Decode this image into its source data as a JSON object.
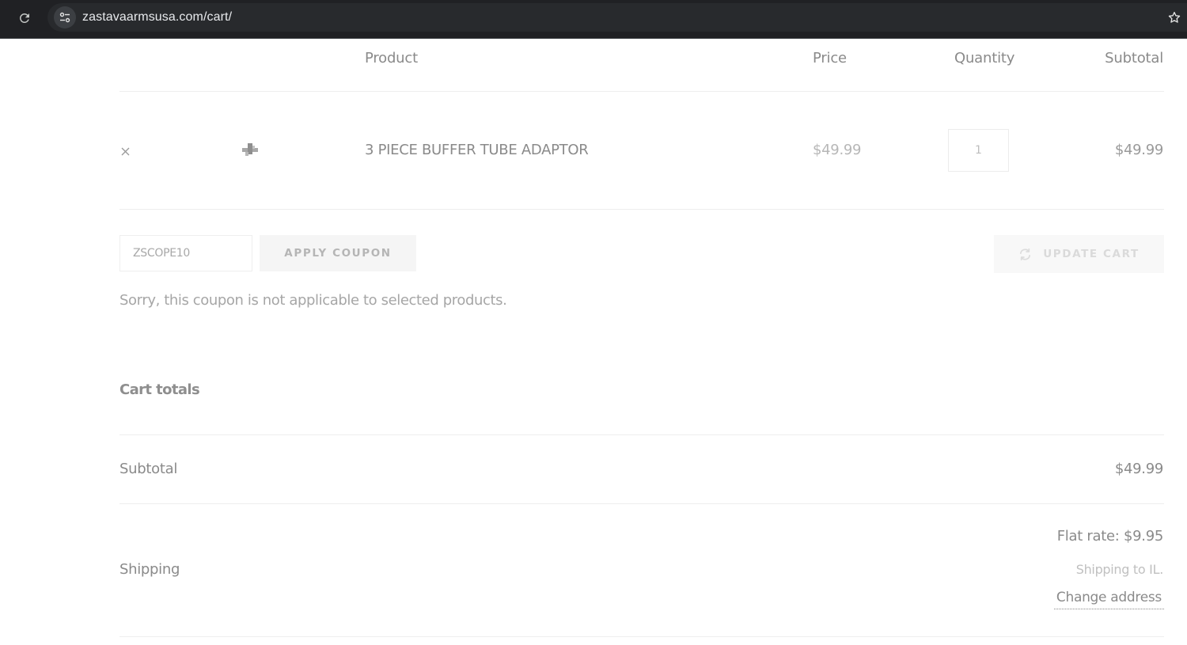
{
  "browser": {
    "url": "zastavaarmsusa.com/cart/"
  },
  "cart": {
    "headers": {
      "product": "Product",
      "price": "Price",
      "quantity": "Quantity",
      "subtotal": "Subtotal"
    },
    "items": [
      {
        "name": "3 PIECE BUFFER TUBE ADAPTOR",
        "price": "$49.99",
        "quantity": "1",
        "subtotal": "$49.99",
        "remove_symbol": "×"
      }
    ],
    "coupon": {
      "value": "ZSCOPE10",
      "apply_label": "APPLY COUPON",
      "error": "Sorry, this coupon is not applicable to selected products."
    },
    "update_label": "UPDATE CART"
  },
  "totals": {
    "title": "Cart totals",
    "subtotal_label": "Subtotal",
    "subtotal_value": "$49.99",
    "shipping_label": "Shipping",
    "shipping_rate": "Flat rate: $9.95",
    "shipping_to": "Shipping to IL.",
    "change_address": "Change address"
  },
  "icons": {
    "reload": "reload-icon",
    "site_info": "tune-icon",
    "bookmark": "star-outline-icon",
    "remove": "close-icon",
    "refresh": "refresh-icon",
    "thumbnail": "product-thumbnail"
  },
  "colors": {
    "chrome_bg": "#202124",
    "omnibox_bg": "#282a2d",
    "text_muted": "#8a8a8a",
    "divider": "#eeeeee"
  }
}
